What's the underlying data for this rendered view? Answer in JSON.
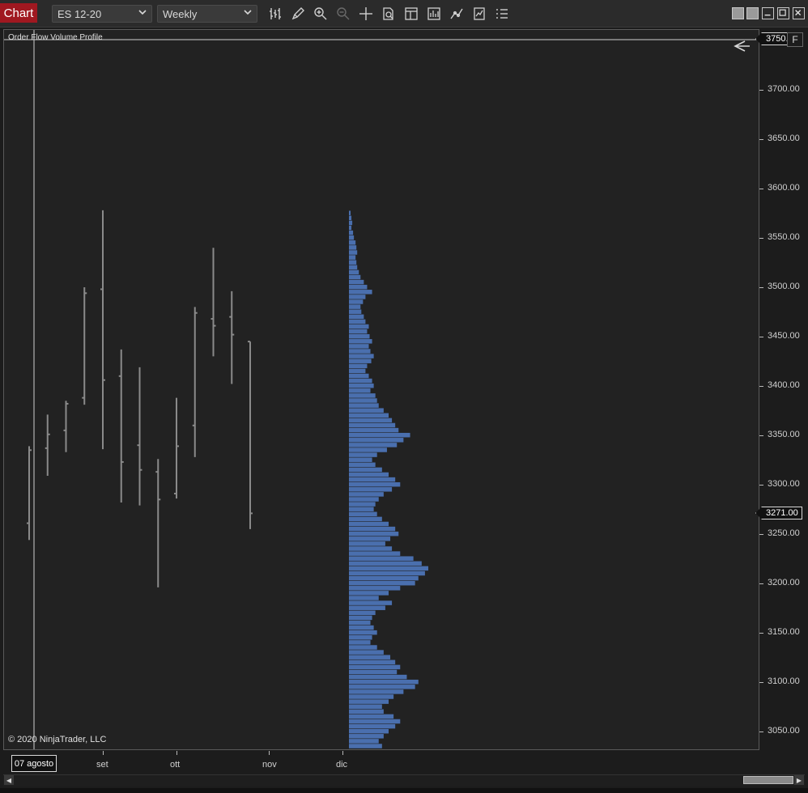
{
  "window": {
    "tab_label": "Chart",
    "instrument": "ES 12-20",
    "timeframe": "Weekly",
    "accent_color": "#a01820"
  },
  "toolbar": {
    "icons": [
      "bar-type-icon",
      "drawing-tool-icon",
      "zoom-in-icon",
      "zoom-out-icon",
      "crosshair-icon",
      "data-box-icon",
      "templates-icon",
      "strategies-icon",
      "indicators-icon",
      "chart-trader-icon",
      "properties-icon"
    ]
  },
  "chart": {
    "indicator_label": "Order Flow Volume Profile",
    "copyright": "© 2020 NinjaTrader, LLC",
    "flag_f": "F",
    "current_price": "3271.00",
    "top_price_flag": "3750.",
    "selected_date": "07 agosto",
    "background_color": "#222222",
    "bar_color": "#8a8a8a",
    "profile_color": "#4a6fae"
  },
  "chart_data": {
    "type": "ohlc",
    "title": "",
    "ylim": [
      3030,
      3760
    ],
    "y_ticks": [
      3700,
      3650,
      3600,
      3550,
      3500,
      3450,
      3400,
      3350,
      3300,
      3250,
      3200,
      3150,
      3100,
      3050
    ],
    "y_tick_labels": [
      "3700.00",
      "3650.00",
      "3600.00",
      "3550.00",
      "3500.00",
      "3450.00",
      "3400.00",
      "3350.00",
      "3300.00",
      "3250.00",
      "3200.00",
      "3150.00",
      "3100.00",
      "3050.00"
    ],
    "x_labels": [
      "set",
      "ott",
      "nov",
      "dic"
    ],
    "bars": [
      {
        "open": 3261,
        "high": 3339,
        "low": 3244,
        "close": 3335
      },
      {
        "open": 3337,
        "high": 3371,
        "low": 3309,
        "close": 3351
      },
      {
        "open": 3355,
        "high": 3385,
        "low": 3333,
        "close": 3382
      },
      {
        "open": 3388,
        "high": 3500,
        "low": 3381,
        "close": 3494
      },
      {
        "open": 3498,
        "high": 3578,
        "low": 3336,
        "close": 3406
      },
      {
        "open": 3410,
        "high": 3437,
        "low": 3282,
        "close": 3323
      },
      {
        "open": 3340,
        "high": 3419,
        "low": 3279,
        "close": 3315
      },
      {
        "open": 3313,
        "high": 3326,
        "low": 3196,
        "close": 3285
      },
      {
        "open": 3291,
        "high": 3388,
        "low": 3286,
        "close": 3339
      },
      {
        "open": 3360,
        "high": 3480,
        "low": 3328,
        "close": 3474
      },
      {
        "open": 3468,
        "high": 3540,
        "low": 3430,
        "close": 3461
      },
      {
        "open": 3470,
        "high": 3496,
        "low": 3402,
        "close": 3452
      },
      {
        "open": 3445,
        "high": 3445,
        "low": 3255,
        "close": 3271
      }
    ],
    "volume_profile": {
      "price_step": 5,
      "prices": [
        3575,
        3570,
        3565,
        3560,
        3555,
        3550,
        3545,
        3540,
        3535,
        3530,
        3525,
        3520,
        3515,
        3510,
        3505,
        3500,
        3495,
        3490,
        3485,
        3480,
        3475,
        3470,
        3465,
        3460,
        3455,
        3450,
        3445,
        3440,
        3435,
        3430,
        3425,
        3420,
        3415,
        3410,
        3405,
        3400,
        3395,
        3390,
        3385,
        3380,
        3375,
        3370,
        3365,
        3360,
        3355,
        3350,
        3345,
        3340,
        3335,
        3330,
        3325,
        3320,
        3315,
        3310,
        3305,
        3300,
        3295,
        3290,
        3285,
        3280,
        3275,
        3270,
        3265,
        3260,
        3255,
        3250,
        3245,
        3240,
        3235,
        3230,
        3225,
        3220,
        3215,
        3210,
        3205,
        3200,
        3195,
        3190,
        3185,
        3180,
        3175,
        3170,
        3165,
        3160,
        3155,
        3150,
        3145,
        3140,
        3135,
        3130,
        3125,
        3120,
        3115,
        3110,
        3105,
        3100,
        3095,
        3090,
        3085,
        3080,
        3075,
        3070,
        3065,
        3060,
        3055,
        3050,
        3045,
        3040,
        3035
      ],
      "volumes": [
        2,
        3,
        4,
        3,
        5,
        6,
        8,
        9,
        10,
        8,
        9,
        10,
        12,
        14,
        18,
        22,
        28,
        20,
        17,
        14,
        15,
        18,
        20,
        24,
        22,
        25,
        28,
        24,
        26,
        30,
        27,
        22,
        20,
        24,
        28,
        30,
        26,
        32,
        34,
        36,
        42,
        48,
        52,
        56,
        60,
        74,
        66,
        58,
        46,
        34,
        28,
        32,
        40,
        48,
        56,
        62,
        52,
        42,
        36,
        32,
        30,
        34,
        40,
        48,
        56,
        60,
        50,
        44,
        52,
        62,
        78,
        88,
        96,
        92,
        84,
        80,
        62,
        48,
        36,
        52,
        44,
        32,
        28,
        26,
        30,
        34,
        28,
        26,
        34,
        42,
        50,
        56,
        62,
        58,
        70,
        84,
        80,
        66,
        54,
        48,
        40,
        42,
        54,
        62,
        56,
        48,
        42,
        36,
        40
      ]
    }
  }
}
